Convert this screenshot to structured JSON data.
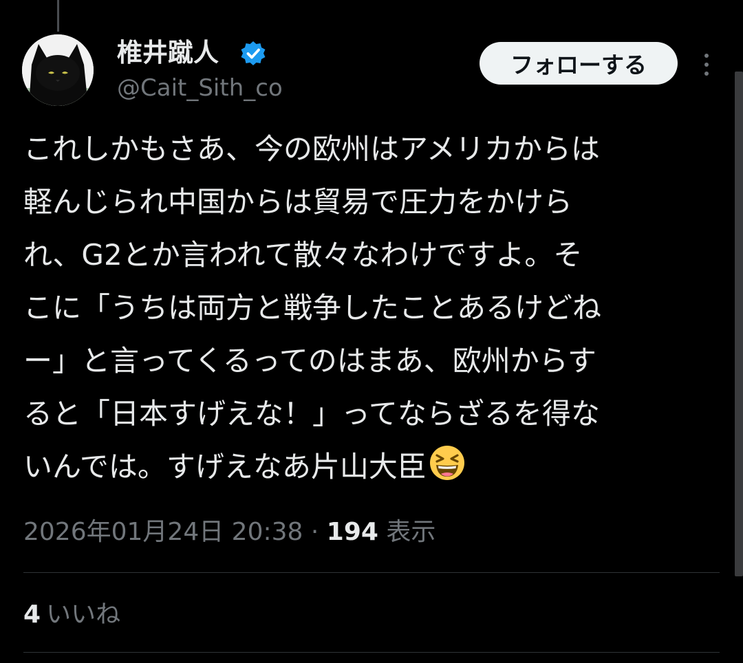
{
  "author": {
    "display_name": "椎井蹴人",
    "handle": "@Cait_Sith_co",
    "verified_icon": "verified-badge-icon",
    "avatar_icon": "black-cat-avatar"
  },
  "header": {
    "follow_label": "フォローする",
    "more_icon": "more-options-icon"
  },
  "tweet": {
    "lines": [
      "これしかもさあ、今の欧州はアメリカからは",
      "軽んじられ中国からは貿易で圧力をかけら",
      "れ、G2とか言われて散々なわけですよ。そ",
      "こに「うちは両方と戦争したことあるけどね",
      "ー」と言ってくるってのはまあ、欧州からす",
      "ると「日本すげえな！」ってならざるを得な",
      "いんでは。すげえなあ片山大臣"
    ],
    "emoji": "grinning-squinting-face-emoji"
  },
  "meta": {
    "timestamp": "2026年01月24日 20:38",
    "separator": "·",
    "views_count": "194",
    "views_label": "表示"
  },
  "engagement": {
    "likes_count": "4",
    "likes_label": "いいね"
  },
  "colors": {
    "background": "#000000",
    "text_primary": "#e7e9ea",
    "text_secondary": "#71767b",
    "verified_blue": "#1d9bf0",
    "follow_button_bg": "#eff3f4",
    "divider": "#2f3336"
  }
}
